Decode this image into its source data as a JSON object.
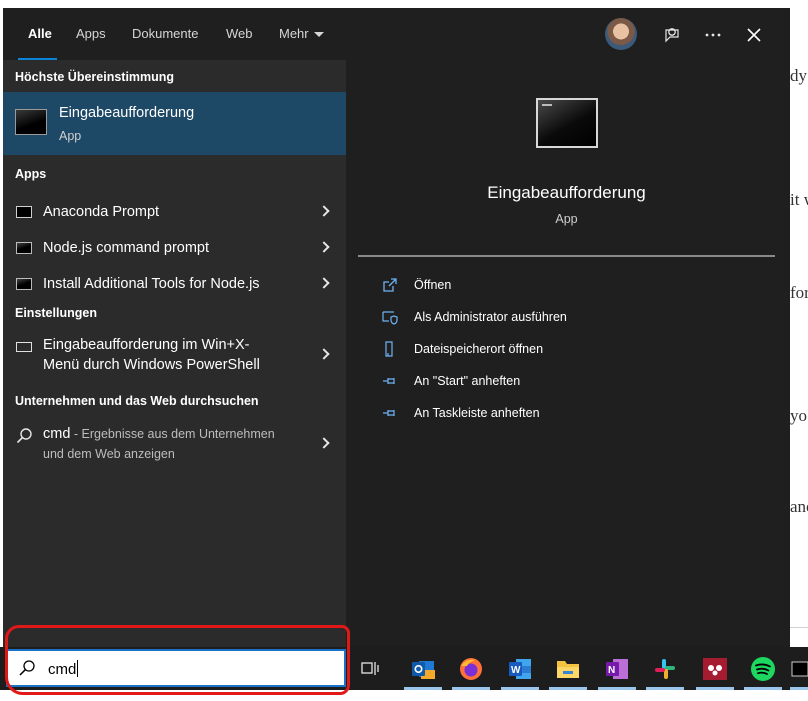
{
  "tabs": [
    {
      "label": "Alle",
      "active": true
    },
    {
      "label": "Apps",
      "active": false
    },
    {
      "label": "Dokumente",
      "active": false
    },
    {
      "label": "Web",
      "active": false
    },
    {
      "label": "Mehr",
      "active": false
    }
  ],
  "top_icons": [
    "avatar",
    "feedback-icon",
    "more-icon",
    "close-icon"
  ],
  "left": {
    "best_match_header": "Höchste Übereinstimmung",
    "best_match": {
      "title": "Eingabeaufforderung",
      "subtitle": "App"
    },
    "apps_header": "Apps",
    "apps": [
      {
        "label": "Anaconda Prompt"
      },
      {
        "label": "Node.js command prompt"
      },
      {
        "label": "Install Additional Tools for Node.js"
      }
    ],
    "settings_header": "Einstellungen",
    "settings_item": {
      "line1": "Eingabeaufforderung im Win+X-",
      "line2": "Menü durch Windows PowerShell"
    },
    "web_header": "Unternehmen und das Web durchsuchen",
    "web_item": {
      "query": "cmd",
      "sep": " - ",
      "desc1": "Ergebnisse aus dem Unternehmen",
      "desc2": "und dem Web anzeigen"
    }
  },
  "detail": {
    "title": "Eingabeaufforderung",
    "subtitle": "App",
    "actions": [
      {
        "label": "Öffnen",
        "icon": "open-icon"
      },
      {
        "label": "Als Administrator ausführen",
        "icon": "shield-icon"
      },
      {
        "label": "Dateispeicherort öffnen",
        "icon": "file-location-icon"
      },
      {
        "label": "An \"Start\" anheften",
        "icon": "pin-icon"
      },
      {
        "label": "An Taskleiste anheften",
        "icon": "pin-icon"
      }
    ]
  },
  "search": {
    "value": "cmd"
  },
  "taskbar_apps": [
    "task-view-icon",
    "outlook-icon",
    "firefox-icon",
    "word-icon",
    "file-explorer-icon",
    "onenote-icon",
    "slack-icon",
    "mendeley-icon",
    "spotify-icon",
    "terminal-icon"
  ],
  "background_doc": [
    "dy",
    "it w",
    "for",
    "yo",
    "anc"
  ],
  "colors": {
    "accent": "#0a84d9",
    "selected": "#1d4866",
    "highlight": "#e01818"
  }
}
